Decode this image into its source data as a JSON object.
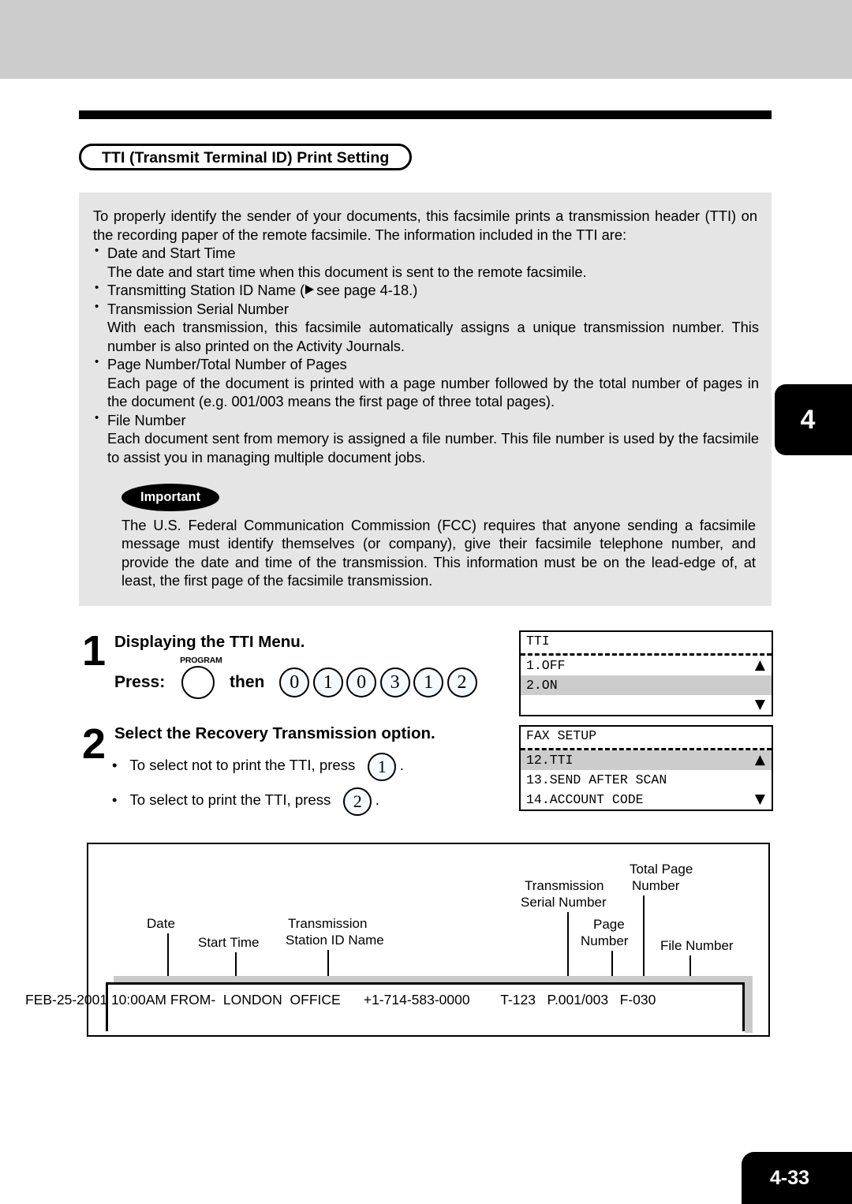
{
  "page": {
    "chapter_tab": "4",
    "page_number": "4-33"
  },
  "section": {
    "title": "TTI (Transmit Terminal ID) Print Setting"
  },
  "intro": {
    "paragraph": "To properly identify the sender of your documents, this facsimile prints a transmission header (TTI) on the recording paper of the remote facsimile.  The information included in the TTI are:",
    "bullets": [
      {
        "label": "Date and Start Time",
        "detail": "The date and start time when this document is sent to the remote facsimile."
      },
      {
        "label_before": "Transmitting Station ID Name (",
        "label_after": "see page 4-18.)",
        "detail": ""
      },
      {
        "label": "Transmission Serial Number",
        "detail": "With each transmission, this facsimile automatically assigns a unique transmission number.  This number is also printed on the Activity Journals."
      },
      {
        "label": "Page Number/Total Number of Pages",
        "detail": "Each page of the document is printed with a page number followed by the total number of pages in the document (e.g. 001/003 means the first page of three total pages)."
      },
      {
        "label": "File Number",
        "detail": "Each document sent from memory is assigned a file number.  This file number is used by the facsimile to assist you in managing multiple document jobs."
      }
    ]
  },
  "important": {
    "badge": "Important",
    "body": "The U.S. Federal Communication Commission (FCC) requires that anyone sending a facsimile message must identify themselves (or company), give their facsimile telephone number, and provide the date and time of the transmission. This information must be on the lead-edge of, at least, the first page of the facsimile transmission."
  },
  "steps": [
    {
      "number": "1",
      "heading": "Displaying the TTI Menu.",
      "press_word": "Press:",
      "program_key_label": "PROGRAM",
      "then_word": "then",
      "keys": [
        "0",
        "1",
        "0",
        "3",
        "1",
        "2"
      ]
    },
    {
      "number": "2",
      "heading": "Select the Recovery Transmission option.",
      "options": [
        {
          "text_before": "To select not to print the TTI, press",
          "key": "1",
          "text_after": "."
        },
        {
          "text_before": "To select to print the TTI, press",
          "key": "2",
          "text_after": "."
        }
      ]
    }
  ],
  "lcd_panels": [
    {
      "title": "TTI",
      "rows": [
        {
          "text": "1.OFF",
          "highlight": false,
          "arrow": "▲"
        },
        {
          "text": "2.ON",
          "highlight": true,
          "arrow": ""
        },
        {
          "text": "",
          "highlight": false,
          "arrow": "▼"
        }
      ]
    },
    {
      "title": "FAX SETUP",
      "rows": [
        {
          "text": "12.TTI",
          "highlight": true,
          "arrow": "▲"
        },
        {
          "text": "13.SEND AFTER SCAN",
          "highlight": false,
          "arrow": ""
        },
        {
          "text": "14.ACCOUNT CODE",
          "highlight": false,
          "arrow": "▼"
        }
      ]
    }
  ],
  "diagram": {
    "labels": [
      {
        "name": "date",
        "text": "Date"
      },
      {
        "name": "start-time",
        "text": "Start Time"
      },
      {
        "name": "transmission-station-id-name-l1",
        "text": "Transmission"
      },
      {
        "name": "transmission-station-id-name-l2",
        "text": "Station ID Name"
      },
      {
        "name": "transmission-serial-number-l1",
        "text": "Transmission"
      },
      {
        "name": "transmission-serial-number-l2",
        "text": "Serial  Number"
      },
      {
        "name": "page-number-l1",
        "text": "Page"
      },
      {
        "name": "page-number-l2",
        "text": "Number"
      },
      {
        "name": "total-page-number-l1",
        "text": "Total Page"
      },
      {
        "name": "total-page-number-l2",
        "text": "Number"
      },
      {
        "name": "file-number",
        "text": "File Number"
      }
    ],
    "fax_header_line": "FEB-25-2001 10:00AM FROM-  LONDON  OFFICE      +1-714-583-0000        T-123   P.001/003   F-030"
  }
}
